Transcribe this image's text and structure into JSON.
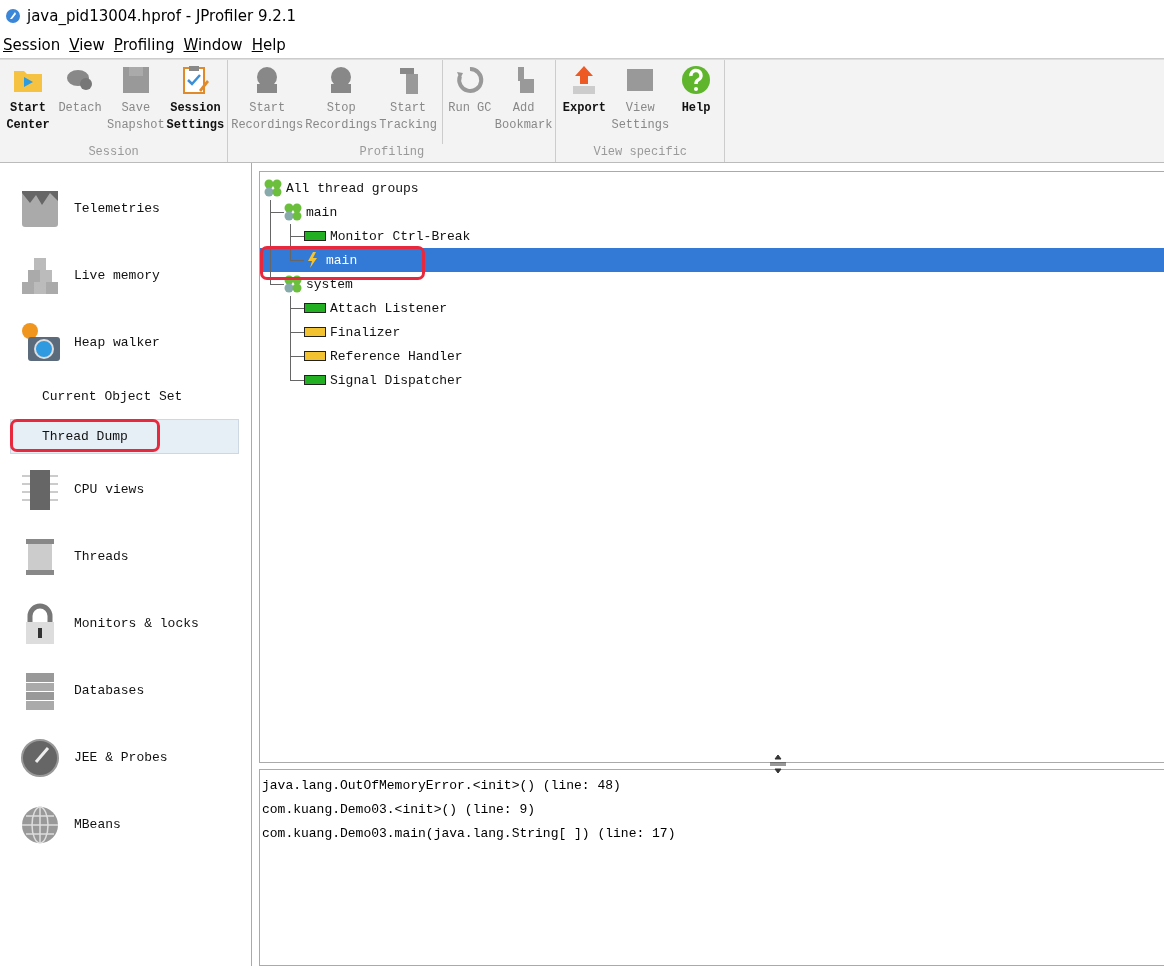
{
  "window": {
    "title": "java_pid13004.hprof - JProfiler 9.2.1"
  },
  "menu": [
    "Session",
    "View",
    "Profiling",
    "Window",
    "Help"
  ],
  "toolbar": [
    {
      "label": "Session",
      "buttons": [
        {
          "label": "Start\nCenter",
          "kind": "start-center",
          "disabled": false,
          "divider_before": false
        },
        {
          "label": "Detach",
          "kind": "detach",
          "disabled": true,
          "divider_before": false
        },
        {
          "label": "Save\nSnapshot",
          "kind": "save",
          "disabled": true,
          "divider_before": false
        },
        {
          "label": "Session\nSettings",
          "kind": "settings",
          "disabled": false,
          "divider_before": false
        }
      ]
    },
    {
      "label": "Profiling",
      "buttons": [
        {
          "label": "Start\nRecordings",
          "kind": "record",
          "disabled": true,
          "divider_before": false
        },
        {
          "label": "Stop\nRecordings",
          "kind": "record",
          "disabled": true,
          "divider_before": false
        },
        {
          "label": "Start\nTracking",
          "kind": "tracking",
          "disabled": true,
          "divider_before": false
        },
        {
          "label": "Run GC",
          "kind": "gc",
          "disabled": true,
          "divider_before": true
        },
        {
          "label": "Add\nBookmark",
          "kind": "bookmark",
          "disabled": true,
          "divider_before": false
        }
      ]
    },
    {
      "label": "View specific",
      "buttons": [
        {
          "label": "Export",
          "kind": "export",
          "disabled": false,
          "divider_before": false
        },
        {
          "label": "View\nSettings",
          "kind": "view-settings",
          "disabled": true,
          "divider_before": false
        },
        {
          "label": "Help",
          "kind": "help",
          "disabled": false,
          "divider_before": false
        }
      ]
    }
  ],
  "sidebar": {
    "items": [
      {
        "label": "Telemetries",
        "kind": "telemetries",
        "selected": false,
        "annotated": false
      },
      {
        "label": "Live memory",
        "kind": "memory",
        "selected": false,
        "annotated": false
      },
      {
        "label": "Heap walker",
        "kind": "heap",
        "selected": false,
        "annotated": false
      },
      {
        "label": "Current Object Set",
        "kind": "sub",
        "selected": false,
        "annotated": false
      },
      {
        "label": "Thread Dump",
        "kind": "sub",
        "selected": true,
        "annotated": true
      },
      {
        "label": "CPU views",
        "kind": "cpu",
        "selected": false,
        "annotated": false
      },
      {
        "label": "Threads",
        "kind": "threads",
        "selected": false,
        "annotated": false
      },
      {
        "label": "Monitors & locks",
        "kind": "lock",
        "selected": false,
        "annotated": false
      },
      {
        "label": "Databases",
        "kind": "database",
        "selected": false,
        "annotated": false
      },
      {
        "label": "JEE & Probes",
        "kind": "gauge",
        "selected": false,
        "annotated": false
      },
      {
        "label": "MBeans",
        "kind": "globe",
        "selected": false,
        "annotated": false
      }
    ]
  },
  "thread_tree": [
    {
      "label": "All thread groups",
      "kind": "group",
      "selected": false,
      "annotated": false,
      "children": [
        {
          "label": "main",
          "kind": "group",
          "selected": false,
          "annotated": false,
          "children": [
            {
              "label": "Monitor Ctrl-Break",
              "kind": "thread",
              "color": "#22b022",
              "selected": false,
              "annotated": false
            },
            {
              "label": "main",
              "kind": "running",
              "selected": true,
              "annotated": true
            }
          ]
        },
        {
          "label": "system",
          "kind": "group",
          "selected": false,
          "annotated": false,
          "children": [
            {
              "label": "Attach Listener",
              "kind": "thread",
              "color": "#22b022",
              "selected": false,
              "annotated": false
            },
            {
              "label": "Finalizer",
              "kind": "thread",
              "color": "#f2c230",
              "selected": false,
              "annotated": false
            },
            {
              "label": "Reference Handler",
              "kind": "thread",
              "color": "#f2c230",
              "selected": false,
              "annotated": false
            },
            {
              "label": "Signal Dispatcher",
              "kind": "thread",
              "color": "#22b022",
              "selected": false,
              "annotated": false
            }
          ]
        }
      ]
    }
  ],
  "stack_trace": [
    "java.lang.OutOfMemoryError.<init>() (line: 48)",
    "com.kuang.Demo03.<init>() (line: 9)",
    "com.kuang.Demo03.main(java.lang.String[ ]) (line: 17)"
  ]
}
